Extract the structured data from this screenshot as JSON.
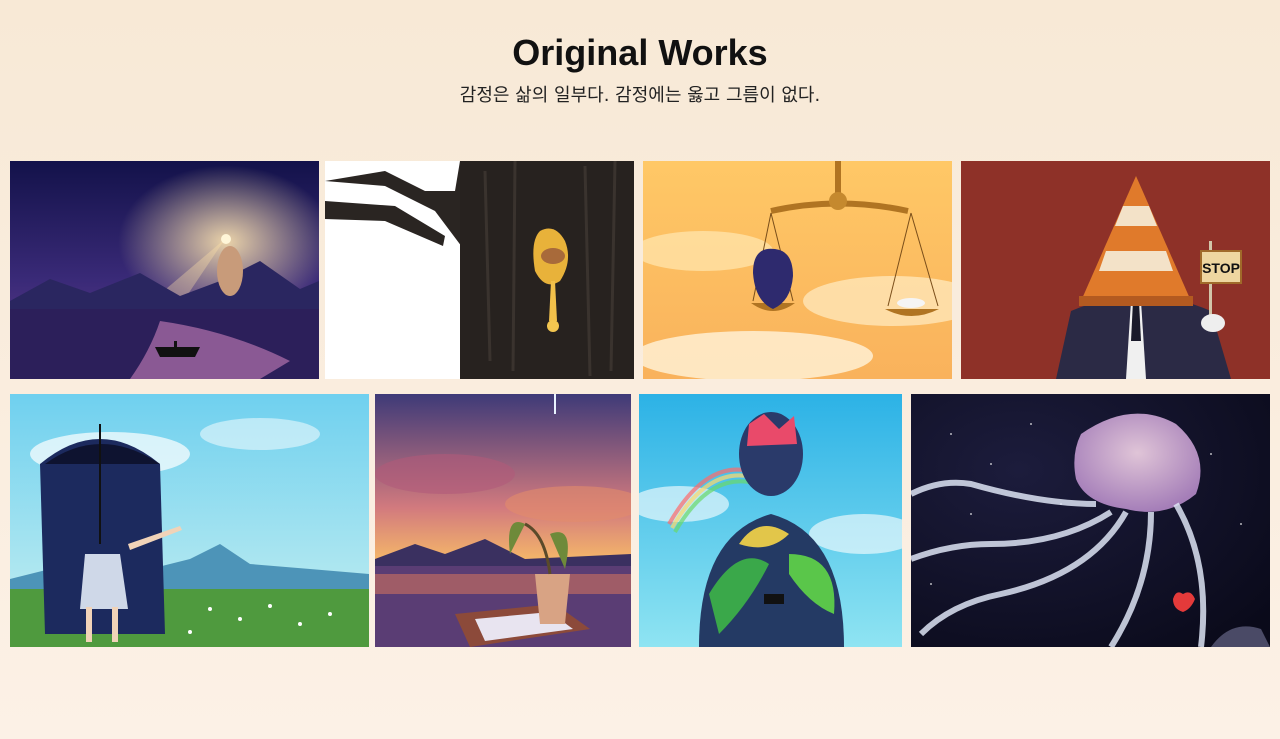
{
  "header": {
    "title": "Original Works",
    "subtitle": "감정은 삶의 일부다. 감정에는 옳고 그름이 없다."
  },
  "gallery": {
    "sign_text": "STOP"
  },
  "colors": {
    "background": "#f8e9d6",
    "title": "#111111"
  }
}
